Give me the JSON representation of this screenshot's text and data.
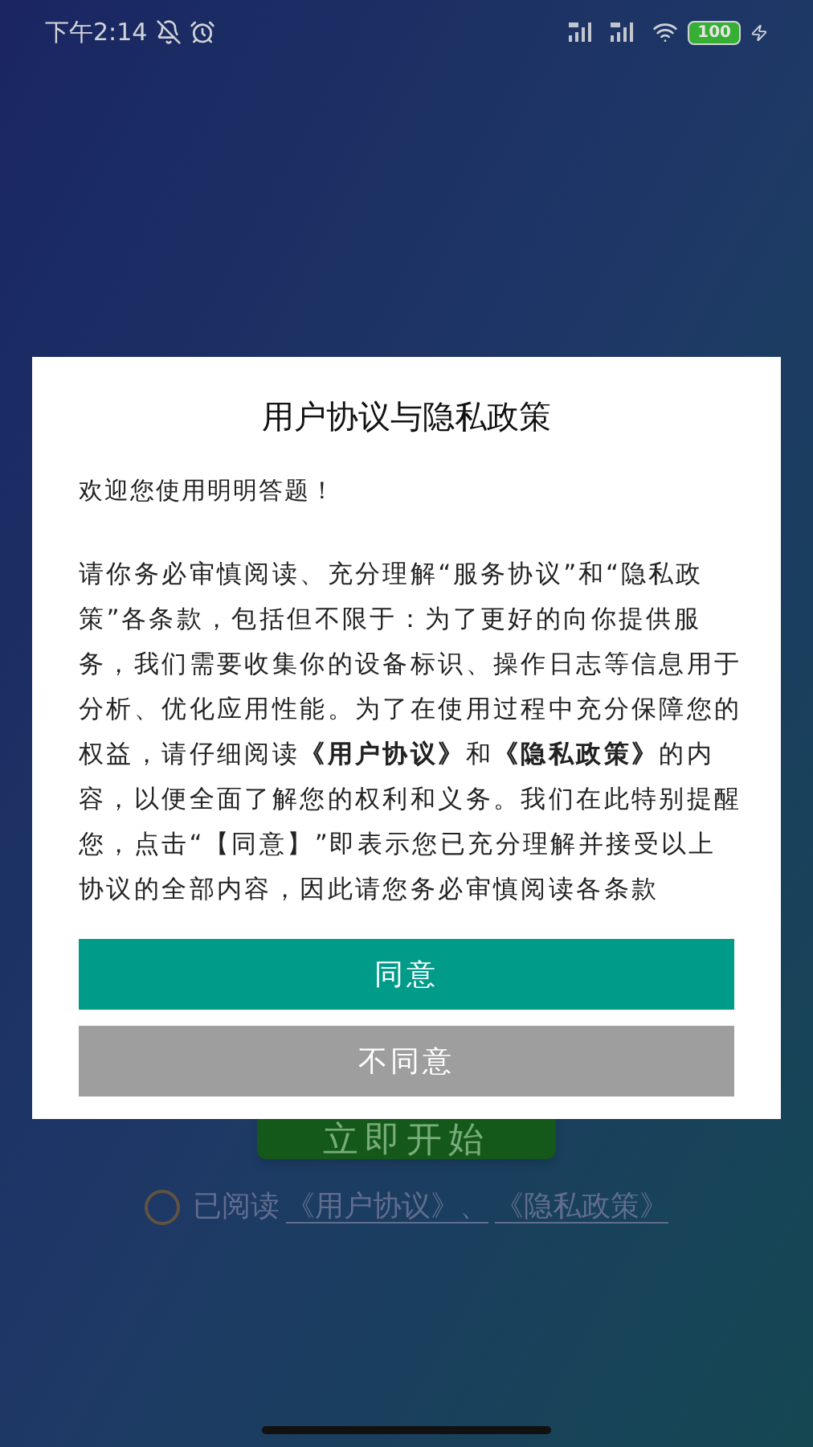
{
  "status_bar": {
    "time": "下午2:14",
    "battery": "100"
  },
  "start_button": {
    "label": "立即开始"
  },
  "agreement": {
    "checked": false,
    "prefix": "已阅读",
    "links": [
      "《用户协议》、",
      "《隐私政策》"
    ]
  },
  "dialog": {
    "title": "用户协议与隐私政策",
    "greeting": "欢迎您使用明明答题！",
    "body": "请你务必审慎阅读、充分理解“服务协议”和“隐私政策”各条款，包括但不限于：为了更好的向你提供服务，我们需要收集你的设备标识、操作日志等信息用于分析、优化应用性能。为了在使用过程中充分保障您的权益，请仔细阅读**《用户协议》**和**《隐私政策》**的内容，以便全面了解您的权利和义务。我们在此特别提醒您，点击“【同意】”即表示您已充分理解并接受以上协议的全部内容，因此请您务必审慎阅读各条款",
    "buttons": [
      {
        "label": "同意",
        "kind": "primary"
      },
      {
        "label": "不同意",
        "kind": "secondary"
      }
    ]
  }
}
